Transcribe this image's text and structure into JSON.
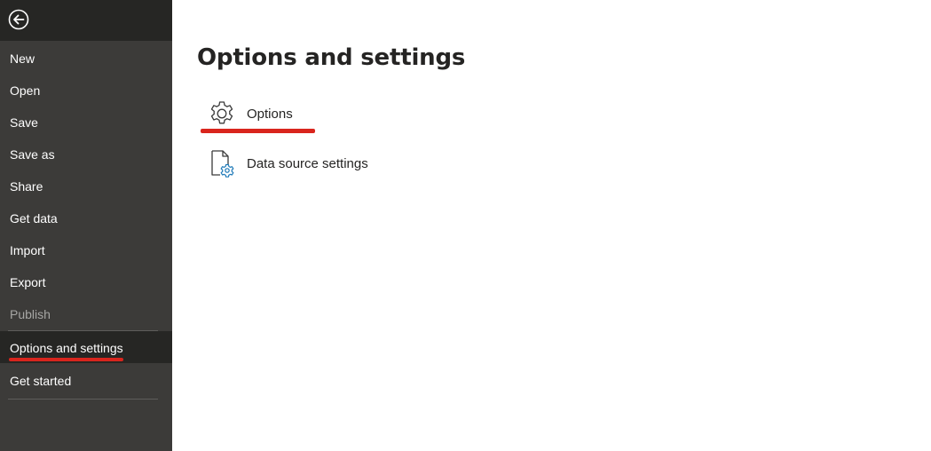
{
  "sidebar": {
    "back_icon": "back-arrow-circle-icon",
    "items": [
      {
        "label": "New",
        "state": "normal"
      },
      {
        "label": "Open",
        "state": "normal"
      },
      {
        "label": "Save",
        "state": "normal"
      },
      {
        "label": "Save as",
        "state": "normal"
      },
      {
        "label": "Share",
        "state": "normal"
      },
      {
        "label": "Get data",
        "state": "normal"
      },
      {
        "label": "Import",
        "state": "normal"
      },
      {
        "label": "Export",
        "state": "normal"
      },
      {
        "label": "Publish",
        "state": "disabled"
      },
      {
        "label": "Options and settings",
        "state": "selected"
      },
      {
        "label": "Get started",
        "state": "normal"
      }
    ]
  },
  "main": {
    "title": "Options and settings",
    "options": [
      {
        "label": "Options",
        "icon": "gear-icon"
      },
      {
        "label": "Data source settings",
        "icon": "data-source-settings-icon"
      }
    ]
  },
  "colors": {
    "sidebar_bg": "#3c3b39",
    "sidebar_dark": "#262624",
    "annotation_red": "#d9251d",
    "icon_accent": "#1f7ab8"
  }
}
